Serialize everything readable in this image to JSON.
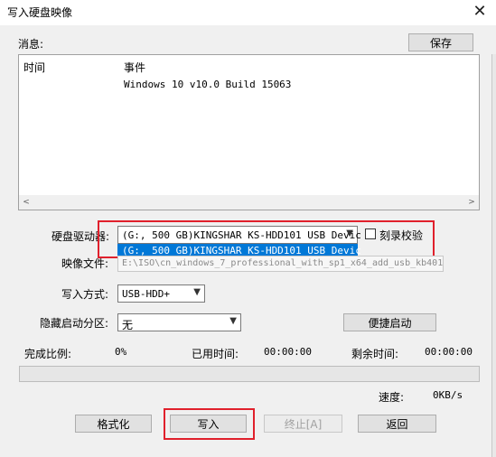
{
  "window": {
    "title": "写入硬盘映像"
  },
  "messages": {
    "label": "消息:",
    "save_label": "保存",
    "col_time": "时间",
    "col_event": "事件",
    "rows": [
      {
        "time": "",
        "event": "Windows 10 v10.0 Build 15063"
      }
    ]
  },
  "drive": {
    "label": "硬盘驱动器:",
    "selected": "(G:, 500 GB)KINGSHAR KS-HDD101 USB Devic",
    "options": [
      "(G:, 500 GB)KINGSHAR KS-HDD101 USB Devic"
    ],
    "verify_label": "刻录校验"
  },
  "image": {
    "label": "映像文件:",
    "value": "E:\\ISO\\cn_windows_7_professional_with_sp1_x64_add_usb_kb4011..."
  },
  "write_mode": {
    "label": "写入方式:",
    "value": "USB-HDD+"
  },
  "hidden_partition": {
    "label": "隐藏启动分区:",
    "value": "无",
    "quick_boot_label": "便捷启动"
  },
  "status": {
    "complete_label": "完成比例:",
    "complete_value": "0%",
    "elapsed_label": "已用时间:",
    "elapsed_value": "00:00:00",
    "remaining_label": "剩余时间:",
    "remaining_value": "00:00:00",
    "speed_label": "速度:",
    "speed_value": "0KB/s",
    "progress": 0
  },
  "actions": {
    "format_label": "格式化",
    "write_label": "写入",
    "stop_label": "终止[A]",
    "back_label": "返回"
  },
  "icons": {
    "close": "close-icon",
    "scroll_left": "scroll-left-icon",
    "scroll_right": "scroll-right-icon",
    "chevron": "chevron-down-icon"
  },
  "colors": {
    "highlight_border": "#e0202c",
    "selection": "#0078d7"
  }
}
